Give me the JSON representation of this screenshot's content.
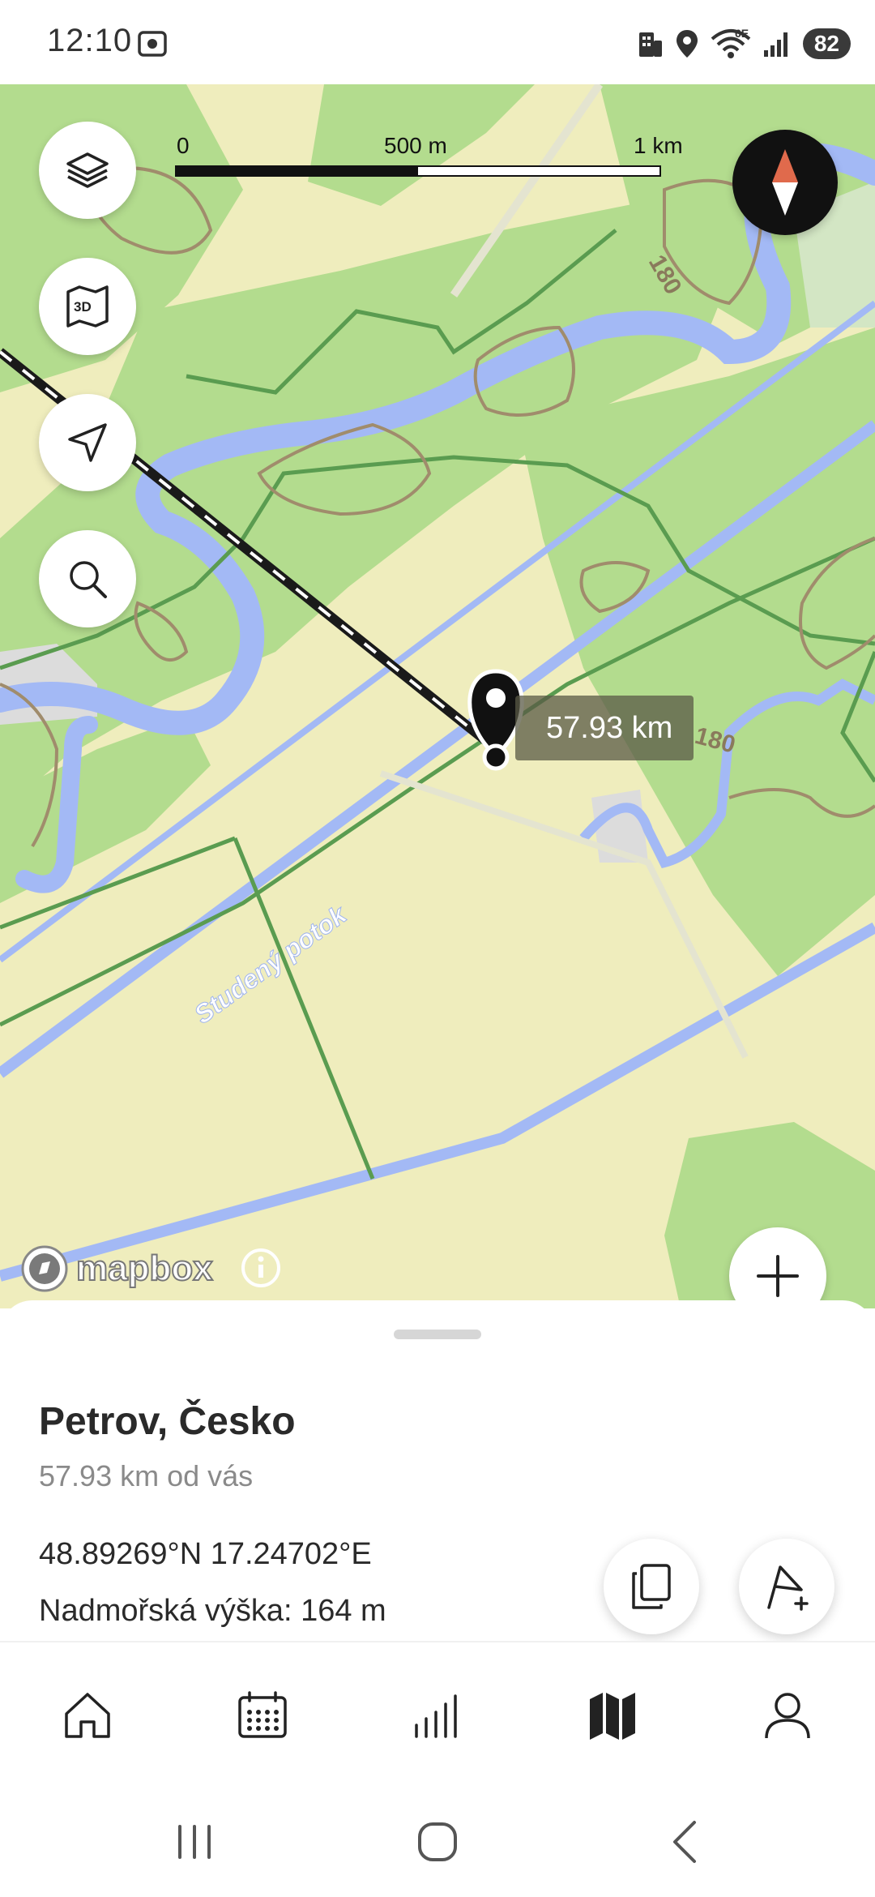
{
  "status_bar": {
    "time": "12:10",
    "battery": "82",
    "network": "6E",
    "icons": [
      "screenshot-icon",
      "building-icon",
      "location-icon",
      "wifi-icon",
      "signal-icon",
      "battery-icon"
    ]
  },
  "map": {
    "scale": {
      "start": "0",
      "mid": "500 m",
      "end": "1 km"
    },
    "contour_labels": [
      "180",
      "180"
    ],
    "stream_label": "Studený potok",
    "distance_label": "57.93 km",
    "attribution": "mapbox",
    "buttons": [
      "layers-icon",
      "3d-map-icon",
      "navigate-icon",
      "search-icon",
      "compass-icon",
      "zoom-in-icon"
    ],
    "colors": {
      "land": "#efedbd",
      "forest": "#b3dc8e",
      "water": "#a3b9f5",
      "contour": "#a08c6c",
      "boundary": "#5a9c50"
    }
  },
  "sheet": {
    "title": "Petrov, Česko",
    "distance": "57.93 km od vás",
    "coordinates": "48.89269°N 17.24702°E",
    "elevation": "Nadmořská výška: 164 m",
    "actions": [
      "copy-icon",
      "add-route-flag-icon"
    ]
  },
  "bottom_nav": {
    "items": [
      "home-icon",
      "calendar-icon",
      "stats-icon",
      "map-icon",
      "profile-icon"
    ],
    "active": "map-icon"
  },
  "system_nav": [
    "recent-apps-icon",
    "home-circle-icon",
    "back-icon"
  ]
}
